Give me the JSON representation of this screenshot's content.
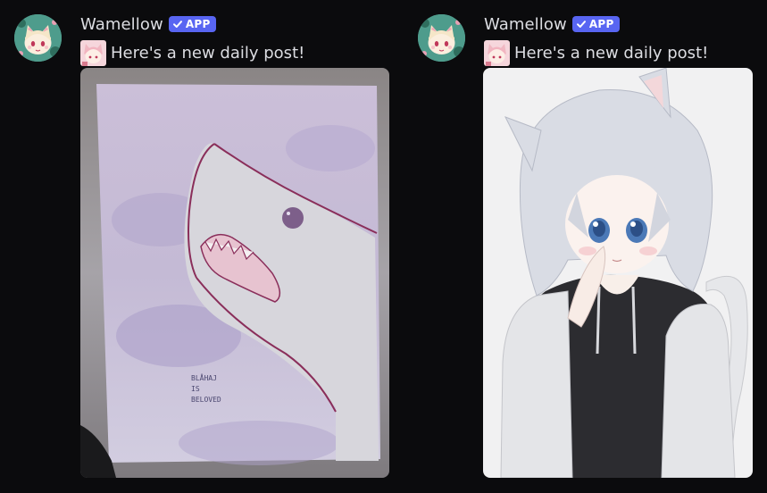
{
  "messages": [
    {
      "author": "Wamellow",
      "badge": "APP",
      "text": "Here's a new daily post!",
      "avatar_icon": "catgirl-avatar",
      "emoji_icon": "catgirl-emoji",
      "attachment": {
        "description": "watercolor shark painting",
        "handwriting": [
          "BLÅHAJ",
          "IS",
          "BELOVED"
        ]
      }
    },
    {
      "author": "Wamellow",
      "badge": "APP",
      "text": "Here's a new daily post!",
      "avatar_icon": "catgirl-avatar",
      "emoji_icon": "catgirl-emoji",
      "attachment": {
        "description": "anime cat girl in black hoodie"
      }
    }
  ],
  "colors": {
    "background": "#0b0b0d",
    "username": "#dcdde2",
    "badge": "#5865f2",
    "text": "#dcdde2"
  }
}
